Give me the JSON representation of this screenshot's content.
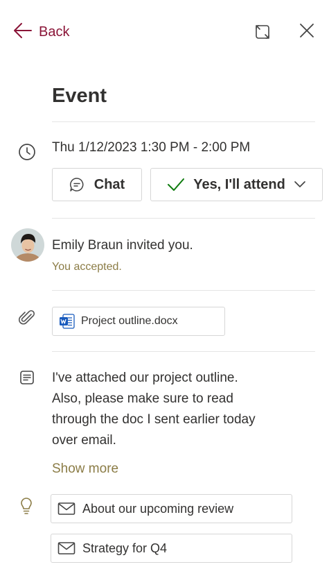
{
  "header": {
    "back_label": "Back"
  },
  "event": {
    "title": "Event",
    "datetime": "Thu 1/12/2023 1:30 PM - 2:00 PM",
    "chat_label": "Chat",
    "response_label": "Yes, I'll attend"
  },
  "organizer": {
    "invited_text": "Emily Braun invited you.",
    "status_text": "You accepted."
  },
  "attachment": {
    "file_name": "Project outline.docx",
    "file_type_icon": "word-doc-icon"
  },
  "description": {
    "lines": [
      "I've attached our project outline.",
      "Also, please make sure to read",
      "through the doc I sent earlier today",
      "over email."
    ],
    "show_more_label": "Show more"
  },
  "related": {
    "items": [
      {
        "label": "About our upcoming review"
      },
      {
        "label": "Strategy for Q4"
      }
    ]
  },
  "colors": {
    "accent_back": "#8a1538",
    "accent_gold": "#8b7c46",
    "check_green": "#107c10",
    "word_blue": "#185abd"
  }
}
